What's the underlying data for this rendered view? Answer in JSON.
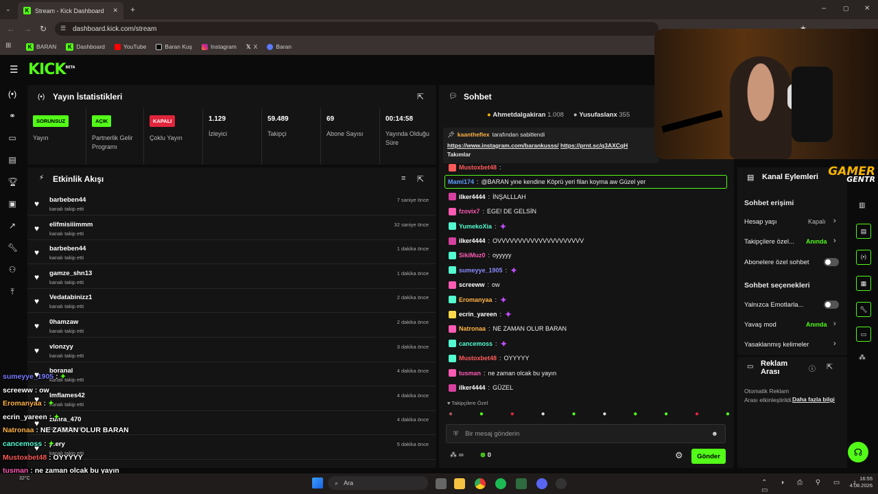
{
  "browser": {
    "tab_title": "Stream - Kick Dashboard",
    "url": "dashboard.kick.com/stream",
    "bookmarks": [
      "BARAN",
      "Dashboard",
      "YouTube",
      "Baran Kuş",
      "Instagram",
      "X",
      "Baran"
    ]
  },
  "logo": {
    "text": "KICK",
    "beta": "BETA"
  },
  "stats": {
    "title": "Yayın İstatistikleri",
    "items": [
      {
        "badge": "SORUNSUZ",
        "label": "Yayın",
        "color": "#53fc18"
      },
      {
        "badge": "AÇIK",
        "label": "Partnerlik Gelir Programı",
        "color": "#53fc18"
      },
      {
        "badge": "KAPALI",
        "label": "Çoklu Yayın",
        "color": "#e0263c"
      },
      {
        "value": "1.129",
        "label": "İzleyici"
      },
      {
        "value": "59.489",
        "label": "Takipçi"
      },
      {
        "value": "69",
        "label": "Abone Sayısı"
      },
      {
        "value": "00:14:58",
        "label": "Yayında Olduğu Süre"
      }
    ]
  },
  "activity": {
    "title": "Etkinlik Akışı",
    "action": "kanalı takip etti",
    "items": [
      {
        "name": "barbeben44",
        "time": "7 saniye önce"
      },
      {
        "name": "elifmisiiimmm",
        "time": "32 saniye önce"
      },
      {
        "name": "barbeben44",
        "time": "1 dakika önce"
      },
      {
        "name": "gamze_shn13",
        "time": "1 dakika önce"
      },
      {
        "name": "Vedatabinizz1",
        "time": "2 dakika önce"
      },
      {
        "name": "0hamzaw",
        "time": "2 dakika önce"
      },
      {
        "name": "vlonzyy",
        "time": "3 dakika önce"
      },
      {
        "name": "boranal",
        "time": "4 dakika önce"
      },
      {
        "name": "lmflames42",
        "time": "4 dakika önce"
      },
      {
        "name": "zuhra_470",
        "time": "4 dakika önce"
      },
      {
        "name": "p.ery",
        "time": "5 dakika önce"
      }
    ]
  },
  "chat": {
    "title": "Sohbet",
    "top_gifters": [
      {
        "name": "Ahmetdalgakiran",
        "count": "1.008"
      },
      {
        "name": "Yusufaslanx",
        "count": "355"
      }
    ],
    "pinned_by": "kaantheflex",
    "pinned_suffix": "tarafından sabitlendi",
    "pinned_link1": "https://www.instagram.com/barankusss/",
    "pinned_link2": "https://prnt.sc/q3AXCqH",
    "pinned_text": "Takımlar",
    "messages": [
      {
        "user": "Mustoxbet48",
        "text": "",
        "color": "#ff5a5a",
        "badge": "#ff5a5a"
      },
      {
        "user": "Mami174",
        "text": "@BARAN yine kendine Köprü yeri filan koyma aw Güzel yer",
        "color": "#5aa0ff",
        "badge": ""
      },
      {
        "user": "ilker4444",
        "text": "İNŞALLLAH",
        "color": "#ffffff",
        "badge": "#d6409f"
      },
      {
        "user": "fzovix7",
        "text": "EGE! DE GELSİN",
        "color": "#ff5ab4",
        "badge": "#ff5ab4"
      },
      {
        "user": "YumekoXia",
        "text": "",
        "color": "#53fcd0",
        "badge": "#53fcd0",
        "emote": true
      },
      {
        "user": "ilker4444",
        "text": "OVVVVVVVVVVVVVVVVVVVVV",
        "color": "#ffffff",
        "badge": "#d6409f"
      },
      {
        "user": "SikiMuz0",
        "text": "oyyyyy",
        "color": "#ff5ab4",
        "badge": "#53fcd0"
      },
      {
        "user": "sumeyye_1905",
        "text": "",
        "color": "#8a8aff",
        "badge": "#53fcd0",
        "emote": true
      },
      {
        "user": "screeww",
        "text": "ow",
        "color": "#ffffff",
        "badge": "#ff5ab4"
      },
      {
        "user": "Eromanyaa",
        "text": "",
        "color": "#ffb347",
        "badge": "#53fcd0",
        "emote": true
      },
      {
        "user": "ecrin_yareen",
        "text": "",
        "color": "#ffffff",
        "badge": "#ffd84a",
        "emote": true
      },
      {
        "user": "Natronaa",
        "text": "NE ZAMAN OLUR BARAN",
        "color": "#ffb347",
        "badge": "#ff5ab4"
      },
      {
        "user": "cancemoss",
        "text": "",
        "color": "#53fcd0",
        "badge": "#53fcd0",
        "emote": true
      },
      {
        "user": "Mustoxbet48",
        "text": "OYYYYY",
        "color": "#ff5a5a",
        "badge": "#53fcd0"
      },
      {
        "user": "tusman",
        "text": "ne zaman olcak bu yayın",
        "color": "#ff5ab4",
        "badge": "#ff5ab4"
      },
      {
        "user": "ilker4444",
        "text": "GÜZEL",
        "color": "#ffffff",
        "badge": "#d6409f"
      }
    ],
    "followers_only": "Takipçilere Özel",
    "placeholder": "Bir mesaj gönderin",
    "points": "0",
    "send": "Gönder"
  },
  "channel_actions": {
    "title": "Kanal Eylemleri",
    "chat_access": "Sohbet erişimi",
    "rows": [
      {
        "label": "Hesap yaşı",
        "value": "Kapalı"
      },
      {
        "label": "Takipçilere özel...",
        "value": "Anında"
      },
      {
        "label": "Abonelere özel sohbet",
        "value": ""
      }
    ],
    "chat_options": "Sohbet seçenekleri",
    "rows2": [
      {
        "label": "Yalnızca Emotlarla...",
        "value": ""
      },
      {
        "label": "Yavaş mod",
        "value": "Anında"
      },
      {
        "label": "Yasaklanmış kelimeler",
        "value": ""
      }
    ]
  },
  "ad_break": {
    "title": "Reklam Arası",
    "text": "Otomatik Reklam Arası etkinleştirildi.",
    "link": "Daha fazla bilgi"
  },
  "overlay_chat": [
    {
      "user": "sumeyye_1905",
      "text": "",
      "color": "#7a7aff"
    },
    {
      "user": "screeww",
      "text": "ow",
      "color": "#ffffff"
    },
    {
      "user": "Eromanyaa",
      "text": "",
      "color": "#ffb347"
    },
    {
      "user": "ecrin_yareen",
      "text": "",
      "color": "#ffffff"
    },
    {
      "user": "Natronaa",
      "text": "NE ZAMAN OLUR BARAN",
      "color": "#ffb347"
    },
    {
      "user": "cancemoss",
      "text": "",
      "color": "#53fcd0"
    },
    {
      "user": "Mustoxbet48",
      "text": "OYYYYY",
      "color": "#ff5a5a"
    },
    {
      "user": "tusman",
      "text": "ne zaman olcak bu yayın",
      "color": "#ff5ab4"
    },
    {
      "user": "ilker4444",
      "text": "GÜZEL",
      "color": "#ffffff"
    }
  ],
  "cam_logo": {
    "line1": "GAMER",
    "line2": "GENTR"
  },
  "taskbar": {
    "search": "Ara",
    "time": "16:55",
    "date": "4.08.2026",
    "weather": "32°C"
  },
  "colors": {
    "accent": "#53fc18",
    "danger": "#e0263c"
  }
}
